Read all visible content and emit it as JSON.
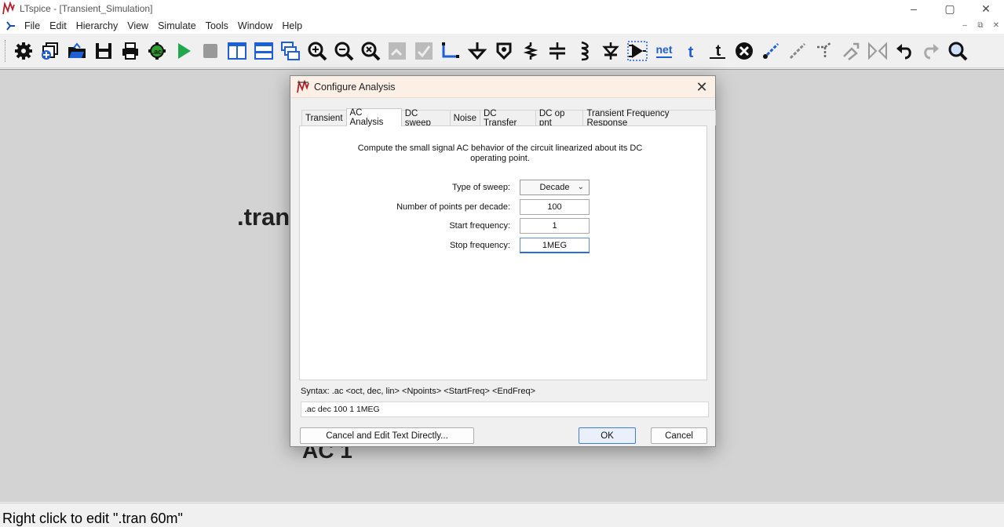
{
  "window": {
    "title": "LTspice - [Transient_Simulation]",
    "controls": {
      "minimize": "–",
      "maximize": "▢",
      "close": "✕"
    }
  },
  "menubar": {
    "items": [
      "File",
      "Edit",
      "Hierarchy",
      "View",
      "Simulate",
      "Tools",
      "Window",
      "Help"
    ],
    "mdi_controls": {
      "minimize": "–",
      "restore": "⧉",
      "close": "✕"
    }
  },
  "toolbar": {
    "net_label": "net",
    "t_label": "t",
    "ac_label": ".ac"
  },
  "canvas": {
    "tran_text": ".tran",
    "ac_text": "AC 1"
  },
  "statusbar": {
    "text": "Right click to edit \".tran 60m\""
  },
  "dialog": {
    "title": "Configure Analysis",
    "close": "✕",
    "tabs": [
      "Transient",
      "AC Analysis",
      "DC sweep",
      "Noise",
      "DC Transfer",
      "DC op pnt",
      "Transient Frequency Response"
    ],
    "active_tab": "AC Analysis",
    "description": "Compute the small signal AC behavior of the circuit linearized about its DC operating point.",
    "fields": {
      "sweep_type": {
        "label": "Type of sweep:",
        "value": "Decade"
      },
      "points": {
        "label": "Number of points per decade:",
        "value": "100"
      },
      "start_freq": {
        "label": "Start frequency:",
        "value": "1"
      },
      "stop_freq": {
        "label": "Stop frequency:",
        "value": "1MEG"
      }
    },
    "syntax": "Syntax:  .ac <oct, dec, lin> <Npoints> <StartFreq> <EndFreq>",
    "command": ".ac dec 100 1 1MEG",
    "buttons": {
      "edit_text": "Cancel and Edit Text Directly...",
      "ok": "OK",
      "cancel": "Cancel"
    }
  }
}
